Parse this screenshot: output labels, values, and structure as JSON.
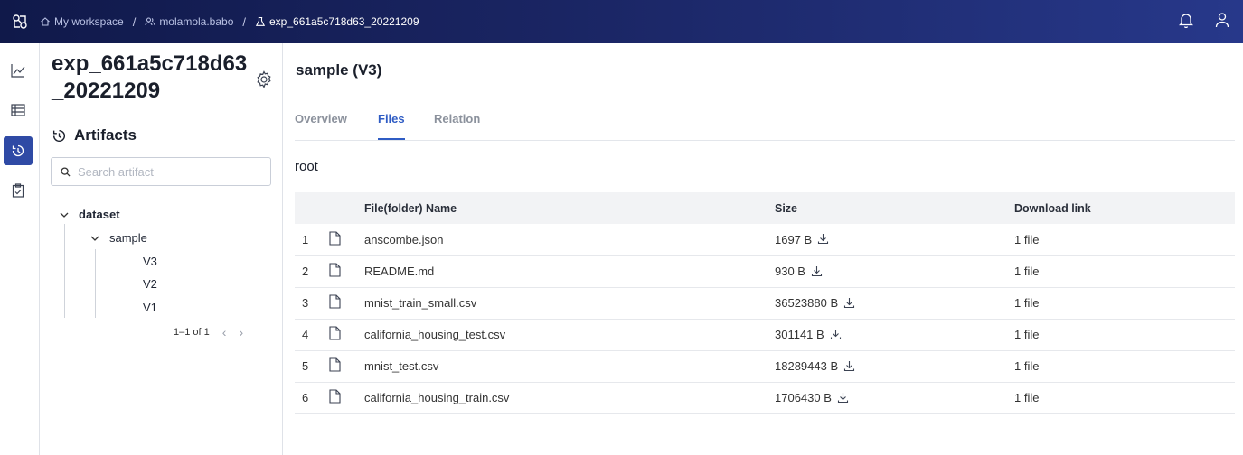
{
  "breadcrumb": {
    "workspace": "My workspace",
    "user": "molamola.babo",
    "experiment": "exp_661a5c718d63_20221209"
  },
  "sidebar_panel": {
    "experiment_title": "exp_661a5c718d63_20221209",
    "section_title": "Artifacts",
    "search_placeholder": "Search artifact",
    "tree": {
      "root": "dataset",
      "child": "sample",
      "versions": [
        "V3",
        "V2",
        "V1"
      ]
    },
    "pagination": "1–1 of 1"
  },
  "main": {
    "title": "sample (V3)",
    "tabs": [
      "Overview",
      "Files",
      "Relation"
    ],
    "active_tab": "Files",
    "path": "root",
    "table": {
      "headers": {
        "name": "File(folder) Name",
        "size": "Size",
        "download": "Download link"
      },
      "rows": [
        {
          "idx": "1",
          "name": "anscombe.json",
          "size": "1697 B",
          "link": "1 file"
        },
        {
          "idx": "2",
          "name": "README.md",
          "size": "930 B",
          "link": "1 file"
        },
        {
          "idx": "3",
          "name": "mnist_train_small.csv",
          "size": "36523880 B",
          "link": "1 file"
        },
        {
          "idx": "4",
          "name": "california_housing_test.csv",
          "size": "301141 B",
          "link": "1 file"
        },
        {
          "idx": "5",
          "name": "mnist_test.csv",
          "size": "18289443 B",
          "link": "1 file"
        },
        {
          "idx": "6",
          "name": "california_housing_train.csv",
          "size": "1706430 B",
          "link": "1 file"
        }
      ]
    }
  },
  "icons": {
    "logo": "cube-network-icon",
    "rail": [
      "chart-line-icon",
      "table-icon",
      "history-icon",
      "clipboard-check-icon"
    ],
    "top": [
      "bell-icon",
      "user-icon"
    ]
  },
  "colors": {
    "topbar": "#1a2563",
    "accent": "#2f5cc4",
    "rail_active": "#2f4aa5"
  }
}
